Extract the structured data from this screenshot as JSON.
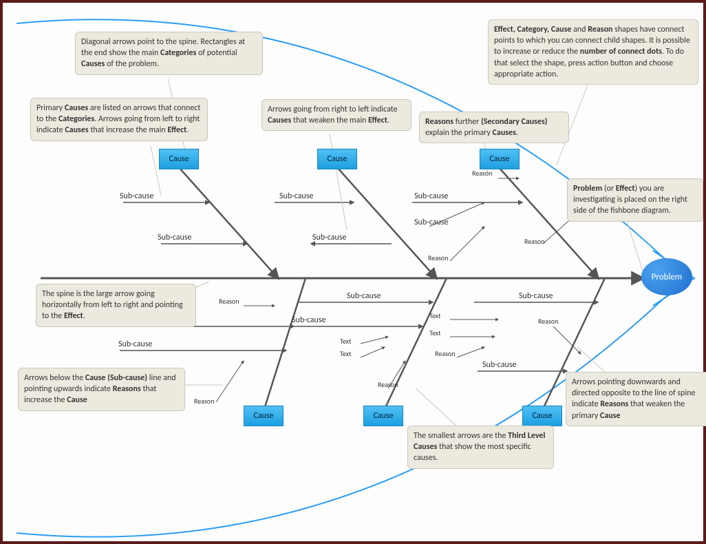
{
  "problem": "Problem",
  "cause": "Cause",
  "subcause": "Sub-cause",
  "reason": "Reason",
  "text": "Text",
  "callouts": {
    "c1": {
      "html": "Diagonal arrows point to the spine. Rectangles at the end show the main <b>Categories</b> of potential <b>Causes</b> of the problem."
    },
    "c2": {
      "html": "Primary <b>Causes</b> are listed on arrows that connect to the <b>Categories</b>. Arrows going from left to right indicate <b>Causes</b> that increase the main <b>Effect</b>."
    },
    "c3": {
      "html": "Arrows going from right to left indicate <b>Causes</b> that weaken the main <b>Effect</b>."
    },
    "c4": {
      "html": "<b>Reasons</b> further <b>(Secondary Causes)</b> explain the primary <b>Causes</b>."
    },
    "c5": {
      "html": "<b>Effect, Category, Cause</b> and <b>Reason</b> shapes have connect points to which you can connect child shapes. It is possible to increase or reduce the <b>number of connect dots</b>. To do that select the shape, press action button and choose appropriate action."
    },
    "c6": {
      "html": "<b>Problem</b> (or <b>Effect</b>) you are investigating is placed on the right side of the fishbone diagram."
    },
    "c7": {
      "html": "The spine is the large arrow going horizontally from left to right and pointing to the <b>Effect</b>."
    },
    "c8": {
      "html": "Arrows below the <b>Cause (Sub-cause)</b> line and pointing upwards indicate <b>Reasons</b> that increase the <b>Cause</b>"
    },
    "c9": {
      "html": "The smallest arrows are the <b>Third Level Causes</b> that show the most specific causes."
    },
    "c10": {
      "html": "Arrows pointing downwards and directed opposite to the line of spine indicate <b>Reasons</b> that weaken the primary <b>Cause</b>"
    }
  }
}
